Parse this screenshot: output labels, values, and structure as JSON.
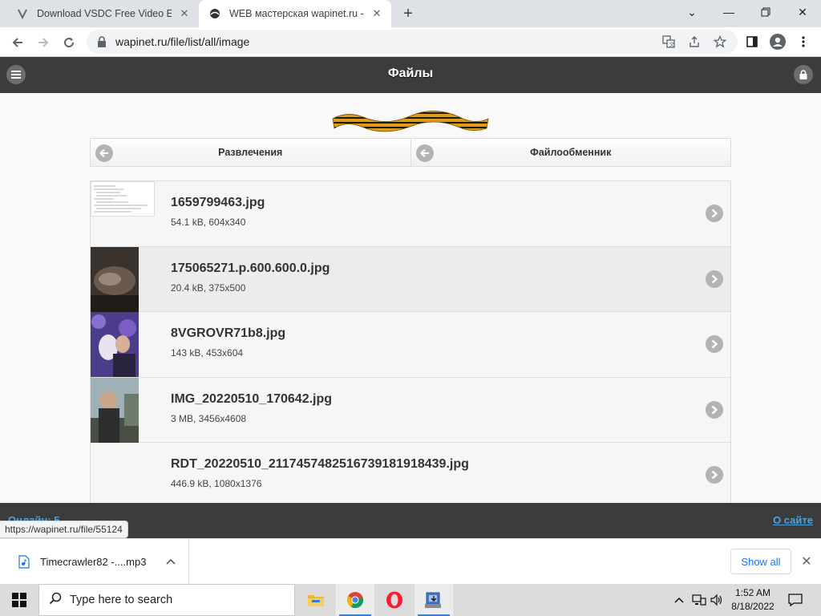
{
  "browser": {
    "tabs": [
      {
        "title": "Download VSDC Free Video Editor",
        "active": false
      },
      {
        "title": "WEB мастерская wapinet.ru - Файлы",
        "active": true
      }
    ],
    "new_tab": "+",
    "window_controls": {
      "minimize": "—",
      "maximize": "▢",
      "close": "✕"
    },
    "url": "wapinet.ru/file/list/all/image",
    "status_url": "https://wapinet.ru/file/55124"
  },
  "site": {
    "title": "Файлы",
    "nav": {
      "back_left": "Развлечения",
      "back_right": "Файлообменник"
    },
    "files": [
      {
        "name": "1659799463.jpg",
        "meta": "54.1 kB, 604x340"
      },
      {
        "name": "175065271.p.600.600.0.jpg",
        "meta": "20.4 kB, 375x500"
      },
      {
        "name": "8VGROVR71b8.jpg",
        "meta": "143 kB, 453x604"
      },
      {
        "name": "IMG_20220510_170642.jpg",
        "meta": "3 MB, 3456x4608"
      },
      {
        "name": "RDT_20220510_2117457482516739181918439.jpg",
        "meta": "446.9 kB, 1080x1376"
      }
    ],
    "footer": {
      "online": "Онлайн: 5",
      "about": "О сайте"
    }
  },
  "downloads": {
    "item": "Timecrawler82 -....mp3",
    "show_all": "Show all",
    "close": "✕"
  },
  "taskbar": {
    "search_placeholder": "Type here to search",
    "time": "1:52 AM",
    "date": "8/18/2022"
  },
  "colors": {
    "site_header": "#3c3c3c",
    "link": "#4aa3df",
    "accent": "#1a73e8"
  }
}
